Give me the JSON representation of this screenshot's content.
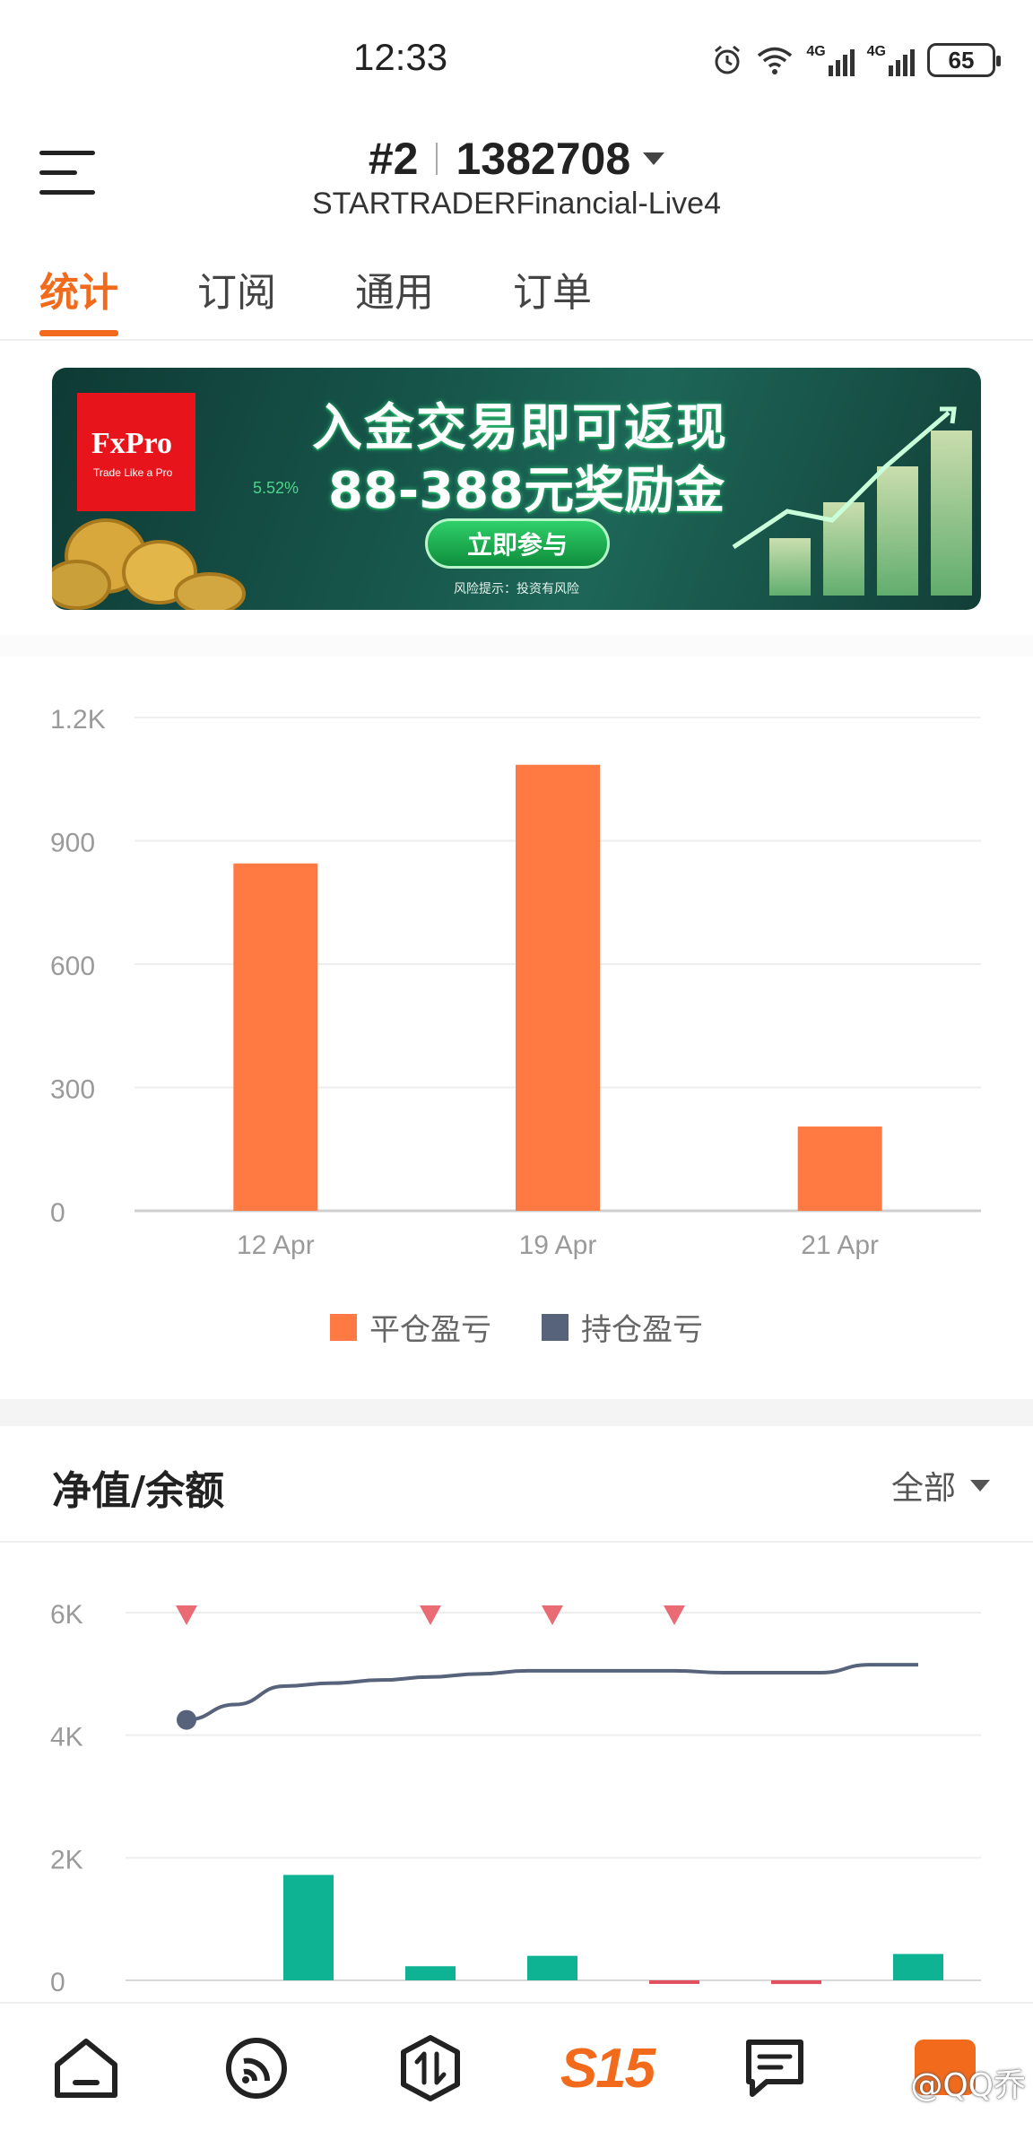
{
  "status_bar": {
    "time": "12:33",
    "network_1": "4G",
    "network_2": "4G",
    "battery": "65"
  },
  "header": {
    "account_index": "#2",
    "account_number": "1382708",
    "server": "STARTRADERFinancial-Live4"
  },
  "tabs": [
    {
      "label": "统计",
      "active": true
    },
    {
      "label": "订阅",
      "active": false
    },
    {
      "label": "通用",
      "active": false
    },
    {
      "label": "订单",
      "active": false
    }
  ],
  "banner": {
    "logo_text": "FxPro",
    "logo_tagline": "Trade Like a Pro",
    "headline": "入金交易即可返现",
    "subline": "88-388元奖励金",
    "percent": "5.52%",
    "cta": "立即参与",
    "risk_note": "风险提示：投资有风险"
  },
  "chart_data": [
    {
      "type": "bar",
      "categories": [
        "12 Apr",
        "19 Apr",
        "21 Apr"
      ],
      "series": [
        {
          "name": "平仓盈亏",
          "color": "#ff7a42",
          "values": [
            845,
            1085,
            205
          ]
        },
        {
          "name": "持仓盈亏",
          "color": "#56637a",
          "values": [
            0,
            0,
            0
          ]
        }
      ],
      "ylim": [
        0,
        1200
      ],
      "yticks": [
        "0",
        "300",
        "600",
        "900",
        "1.2K"
      ],
      "ytick_values": [
        0,
        300,
        600,
        900,
        1200
      ],
      "grid": true,
      "legend": "bottom-center"
    },
    {
      "type": "line",
      "title": "净值/余额",
      "filter": "全部",
      "x": [
        1,
        2,
        3,
        4,
        5,
        6,
        7,
        8,
        9,
        10,
        11,
        12,
        13,
        14,
        15,
        16
      ],
      "line_series": {
        "color": "#56637a",
        "values": [
          4250,
          4500,
          4800,
          4850,
          4900,
          4950,
          5000,
          5050,
          5050,
          5050,
          5050,
          5020,
          5020,
          5020,
          5150,
          5150
        ]
      },
      "bar_series": {
        "color": "#0db393",
        "categories": [
          1,
          2,
          3,
          4,
          5,
          6,
          7
        ],
        "values": [
          0,
          1720,
          230,
          400,
          -30,
          -60,
          430
        ]
      },
      "markers": {
        "color": "#e96b74",
        "categories": [
          1,
          3,
          4,
          5
        ]
      },
      "ylim": [
        0,
        6000
      ],
      "yticks": [
        "0",
        "2K",
        "4K",
        "6K"
      ],
      "ytick_values": [
        0,
        2000,
        4000,
        6000
      ],
      "grid": true
    }
  ],
  "bottom_nav": {
    "s15_label": "S15",
    "watermark": "@QQ乔"
  }
}
